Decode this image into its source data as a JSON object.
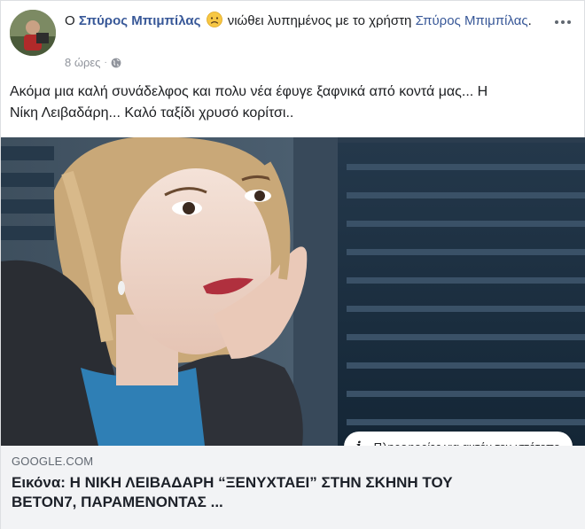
{
  "post": {
    "prefix": "Ο",
    "author": "Σπύρος Μπιμπίλας",
    "feeling_text": "νιώθει λυπημένος με το χρήστη",
    "tagged_user": "Σπύρος Μπιμπίλας",
    "trailing": ".",
    "time": "8 ώρες",
    "separator": "·",
    "audience_icon": "globe-icon",
    "feeling_icon": "sad-face-emoji",
    "text_line1": "Ακόμα μια καλή συνάδελφος και πολυ νέα έφυγε ξαφνικά από κοντά μας... Η",
    "text_line2": "Νίκη Λειβαδάρη... Καλό ταξίδι χρυσό κορίτσι.."
  },
  "link_preview": {
    "info_label": "Πληροφορίες για αυτόν τον ιστότοπο",
    "domain": "GOOGLE.COM",
    "title_line1": "Εικόνα: Η ΝΙΚΗ ΛΕΙΒΑΔΑΡΗ “ΞΕΝΥΧΤΑΕΙ” ΣΤΗΝ ΣΚΗΝΗ ΤΟΥ",
    "title_line2": "ΒΕΤΟΝ7, ΠΑΡΑΜΕΝΟΝΤΑΣ ..."
  },
  "colors": {
    "link_blue": "#385898",
    "meta_gray": "#90949c",
    "link_box_bg": "#f2f3f5"
  }
}
